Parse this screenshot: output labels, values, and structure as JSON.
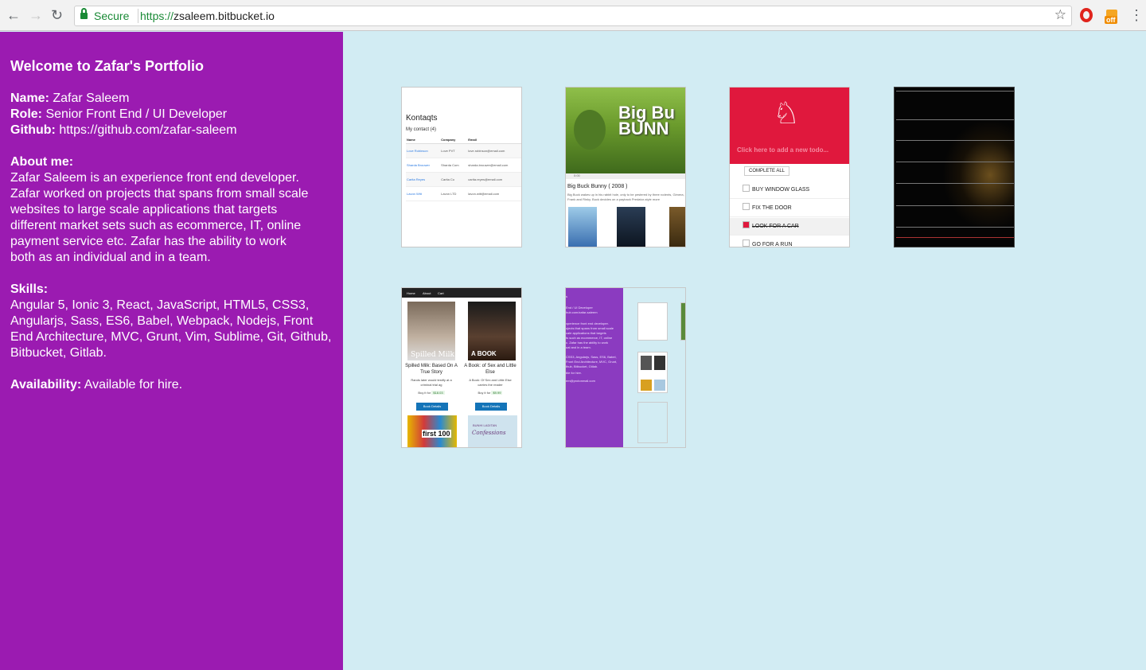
{
  "browser": {
    "secure_label": "Secure",
    "url_scheme": "https://",
    "url_host": "zsaleem.bitbucket.io",
    "ext_badge": "off"
  },
  "sidebar": {
    "title": "Welcome to Zafar's Portfolio",
    "name_label": "Name:",
    "name_value": " Zafar Saleem",
    "role_label": "Role:",
    "role_value": " Senior Front End / UI Developer",
    "github_label": "Github:",
    "github_value": " https://github.com/zafar-saleem",
    "about_label": "About me:",
    "about_lines": [
      "Zafar Saleem is an experience front end developer.",
      "Zafar worked on projects that spans from small scale",
      "websites to large scale applications that targets",
      "different market sets such as ecommerce, IT, online",
      "payment service etc. Zafar has the ability to work",
      "both as an individual and in a team."
    ],
    "skills_label": "Skills:",
    "skills_lines": [
      "Angular 5, Ionic 3, React, JavaScript, HTML5, CSS3,",
      "Angularjs, Sass, ES6, Babel, Webpack, Nodejs, Front",
      "End Architecture, MVC, Grunt, Vim, Sublime, Git, Github,",
      "Bitbucket, Gitlab."
    ],
    "availability_label": "Availability:",
    "availability_value": " Available for hire."
  },
  "thumbs": {
    "kontaqts": {
      "title": "Kontaqts",
      "subtitle": "My contact (4)",
      "headers": [
        "Name",
        "Company",
        "Email"
      ],
      "rows": [
        [
          "Love Robinson",
          "Love PVT",
          "love.robinson@email.com"
        ],
        [
          "Sharda Brouwer",
          "Sharda Com",
          "sharda.brouwer@email.com"
        ],
        [
          "Carita Reyes",
          "Carita Co",
          "carita.reyes@email.com"
        ],
        [
          "Lavon Witt",
          "Lavon LTD",
          "lavon.witt@email.com"
        ]
      ]
    },
    "bunny": {
      "hero_line1": "Big Bu",
      "hero_line2": "BUNN",
      "caption": "Big Buck Bunny ( 2008 )",
      "desc": "Big Buck wakes up in his rabbit hole, only to be pestered by three rodents, Gimera, Frank and Rinky. Buck decides on a payback Predator-style more",
      "time": "0:00"
    },
    "todo": {
      "placeholder": "Click here to add a new todo...",
      "complete_all": "COMPLETE ALL",
      "items": [
        {
          "label": "BUY WINDOW GLASS",
          "done": false
        },
        {
          "label": "FIX THE DOOR",
          "done": false
        },
        {
          "label": "LOOK FOR A CAR",
          "done": true
        },
        {
          "label": "GO FOR A RUN",
          "done": false
        }
      ]
    },
    "books": {
      "nav": [
        "Home",
        "About",
        "Cart"
      ],
      "items": [
        {
          "title": "Spilled Milk: Based On A True Story",
          "quote": "Rands later would testify at a criminal trial ag",
          "price_prefix": "Buy it for",
          "price": "$18.03",
          "button": "Book Details",
          "cover_text": "Spilled Milk"
        },
        {
          "title": "A Book: of Sex and Little Else",
          "quote": "A Book: Of Sex and Little Else carries the reader",
          "price_prefix": "Buy it for",
          "price": "$9.99",
          "button": "Book Details",
          "cover_text": "A BOOK"
        }
      ],
      "cover3_text": "first 100",
      "cover4_line1": "BUNHI LADITAN",
      "cover4_line2": "Confessions"
    },
    "portfolio_mini": {
      "lines": [
        "s",
        "End / UI Developer",
        "hub.com/zafar-saleem",
        "xperience front end developer.",
        "ojects that spans from small scale",
        "cale applications that targets",
        "ts such as ecommerce, IT, online",
        "c. Zafar has the ability to work",
        "ual and in a team.",
        "CSS3, Angularjs, Sass, ES6, Babel,",
        "Front End Architecture, MVC, Grunt,",
        "thub, Bitbucket, Gitlab.",
        "ble for hire.",
        "em@protonmail.com"
      ]
    }
  },
  "colors": {
    "sidebar_bg": "#9b1bb1",
    "gallery_bg": "#d2ecf3",
    "todo_red": "#e0183d",
    "secure_green": "#1a8a36"
  }
}
